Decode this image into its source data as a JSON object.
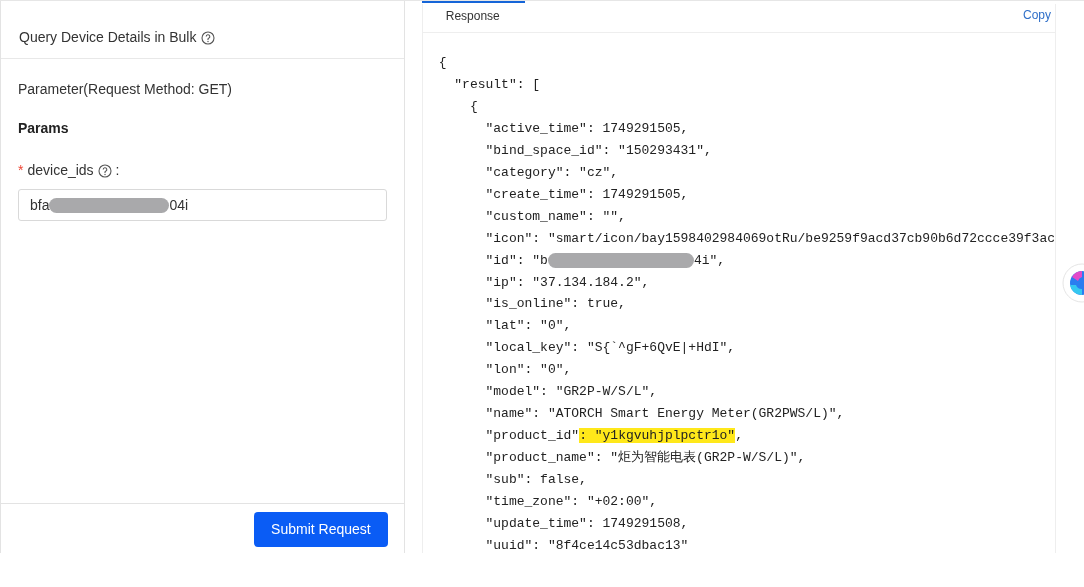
{
  "request_panel": {
    "title": "Query Device Details in Bulk",
    "section_title": "Parameter(Request Method: GET)",
    "params_heading": "Params",
    "field": {
      "required_mark": "*",
      "label": "device_ids",
      "colon": ":",
      "segments": [
        {
          "kind": "plain",
          "text": "bfa"
        },
        {
          "kind": "redacted"
        },
        {
          "kind": "plain",
          "text": "04i"
        }
      ]
    },
    "submit": "Submit Request"
  },
  "response_panel": {
    "tabs": [
      {
        "label": "Response",
        "selected": true
      }
    ],
    "copy": "Copy",
    "code": [
      {
        "segments": [
          {
            "kind": "plain",
            "text": "{"
          }
        ],
        "children": [
          {
            "segments": [
              {
                "kind": "plain",
                "text": "\"result\": ["
              }
            ],
            "children": [
              {
                "segments": [
                  {
                    "kind": "plain",
                    "text": "{"
                  }
                ],
                "children": [
                  {
                    "segments": [
                      {
                        "kind": "plain",
                        "text": "\"active_time\": 1749291505,"
                      }
                    ]
                  },
                  {
                    "segments": [
                      {
                        "kind": "plain",
                        "text": "\"bind_space_id\": \"150293431\","
                      }
                    ]
                  },
                  {
                    "segments": [
                      {
                        "kind": "plain",
                        "text": "\"category\": \"cz\","
                      }
                    ]
                  },
                  {
                    "segments": [
                      {
                        "kind": "plain",
                        "text": "\"create_time\": 1749291505,"
                      }
                    ]
                  },
                  {
                    "segments": [
                      {
                        "kind": "plain",
                        "text": "\"custom_name\": \"\","
                      }
                    ]
                  },
                  {
                    "segments": [
                      {
                        "kind": "plain",
                        "text": "\"icon\": \"smart/icon/bay1598402984069otRu/be9259f9acd37cb90b6d72ccce39f3ac"
                      }
                    ]
                  },
                  {
                    "segments": [
                      {
                        "kind": "plain",
                        "text": "\"id\": \"b"
                      },
                      {
                        "kind": "redacted"
                      },
                      {
                        "kind": "plain",
                        "text": "4i\","
                      }
                    ]
                  },
                  {
                    "segments": [
                      {
                        "kind": "plain",
                        "text": "\"ip\": \"37.134.184.2\","
                      }
                    ]
                  },
                  {
                    "segments": [
                      {
                        "kind": "plain",
                        "text": "\"is_online\": true,"
                      }
                    ]
                  },
                  {
                    "segments": [
                      {
                        "kind": "plain",
                        "text": "\"lat\": \"0\","
                      }
                    ]
                  },
                  {
                    "segments": [
                      {
                        "kind": "plain",
                        "text": "\"local_key\": \"S{`^gF+6QvE|+HdI\","
                      }
                    ]
                  },
                  {
                    "segments": [
                      {
                        "kind": "plain",
                        "text": "\"lon\": \"0\","
                      }
                    ]
                  },
                  {
                    "segments": [
                      {
                        "kind": "plain",
                        "text": "\"model\": \"GR2P-W/S/L\","
                      }
                    ]
                  },
                  {
                    "segments": [
                      {
                        "kind": "plain",
                        "text": "\"name\": \"ATORCH Smart Energy Meter(GR2PWS/L)\","
                      }
                    ]
                  },
                  {
                    "segments": [
                      {
                        "kind": "plain",
                        "text": "\"product_id\""
                      },
                      {
                        "kind": "highlight",
                        "text": ": \"y1kgvuhjplpctr1o\""
                      },
                      {
                        "kind": "plain",
                        "text": ","
                      }
                    ]
                  },
                  {
                    "segments": [
                      {
                        "kind": "plain",
                        "text": "\"product_name\": \"炬为智能电表(GR2P-W/S/L)\","
                      }
                    ]
                  },
                  {
                    "segments": [
                      {
                        "kind": "plain",
                        "text": "\"sub\": false,"
                      }
                    ]
                  },
                  {
                    "segments": [
                      {
                        "kind": "plain",
                        "text": "\"time_zone\": \"+02:00\","
                      }
                    ]
                  },
                  {
                    "segments": [
                      {
                        "kind": "plain",
                        "text": "\"update_time\": 1749291508,"
                      }
                    ]
                  },
                  {
                    "segments": [
                      {
                        "kind": "plain",
                        "text": "\"uuid\": \"8f4ce14c53dbac13\""
                      }
                    ]
                  }
                ]
              }
            ]
          }
        ]
      }
    ]
  }
}
